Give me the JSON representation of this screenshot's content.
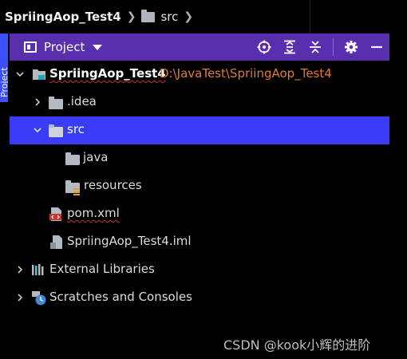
{
  "breadcrumb": {
    "project": "SpriingAop_Test4",
    "folder": "src"
  },
  "side_tab": {
    "label": "Project"
  },
  "tool_window": {
    "title": "Project",
    "actions": [
      "locate-icon",
      "expand-all-icon",
      "collapse-all-icon",
      "gear-icon",
      "hide-icon"
    ]
  },
  "tree": {
    "root": {
      "label": "SpriingAop_Test4",
      "path": "D:\\JavaTest\\SpriingAop_Test4"
    },
    "idea": {
      "label": ".idea"
    },
    "src": {
      "label": "src"
    },
    "java": {
      "label": "java"
    },
    "resources": {
      "label": "resources"
    },
    "pom": {
      "label": "pom.xml"
    },
    "iml": {
      "label": "SpriingAop_Test4.iml"
    },
    "libraries": {
      "label": "External Libraries"
    },
    "scratches": {
      "label": "Scratches and Consoles"
    }
  },
  "watermark": "CSDN @kook小辉的进阶",
  "colors": {
    "header": "#5a2fae",
    "selection": "#3a3df5",
    "path": "#e07a2f",
    "side_tab": "#3b4ffa"
  }
}
